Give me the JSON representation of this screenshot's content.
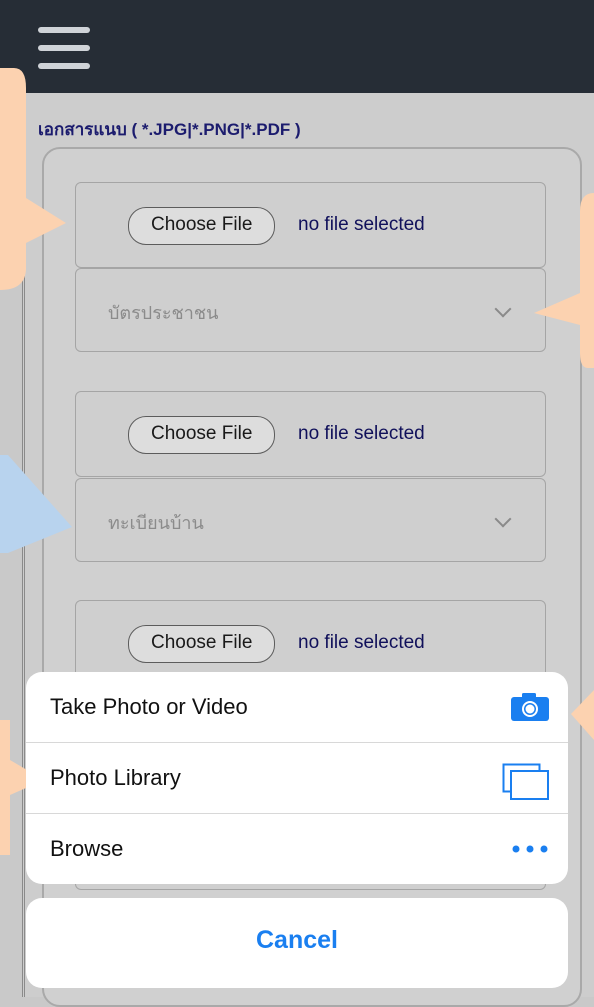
{
  "header": {
    "menu_icon": "hamburger-menu-icon"
  },
  "upload_section": {
    "label": "เอกสารแนบ ( *.JPG|*.PNG|*.PDF )",
    "files": [
      {
        "button": "Choose File",
        "status": "no file selected",
        "doc_type": "บัตรประชาชน"
      },
      {
        "button": "Choose File",
        "status": "no file selected",
        "doc_type": "ทะเบียนบ้าน"
      },
      {
        "button": "Choose File",
        "status": "no file selected"
      }
    ]
  },
  "action_sheet": {
    "options": [
      {
        "label": "Take Photo or Video",
        "icon": "camera-icon"
      },
      {
        "label": "Photo Library",
        "icon": "photo-library-icon"
      },
      {
        "label": "Browse",
        "icon": "more-icon"
      }
    ],
    "cancel_label": "Cancel"
  },
  "colors": {
    "header_bg": "#262d36",
    "accent_blue": "#1a7ff0",
    "bubble_peach": "#fcd2b0",
    "bubble_blue": "#b8d3ee"
  }
}
